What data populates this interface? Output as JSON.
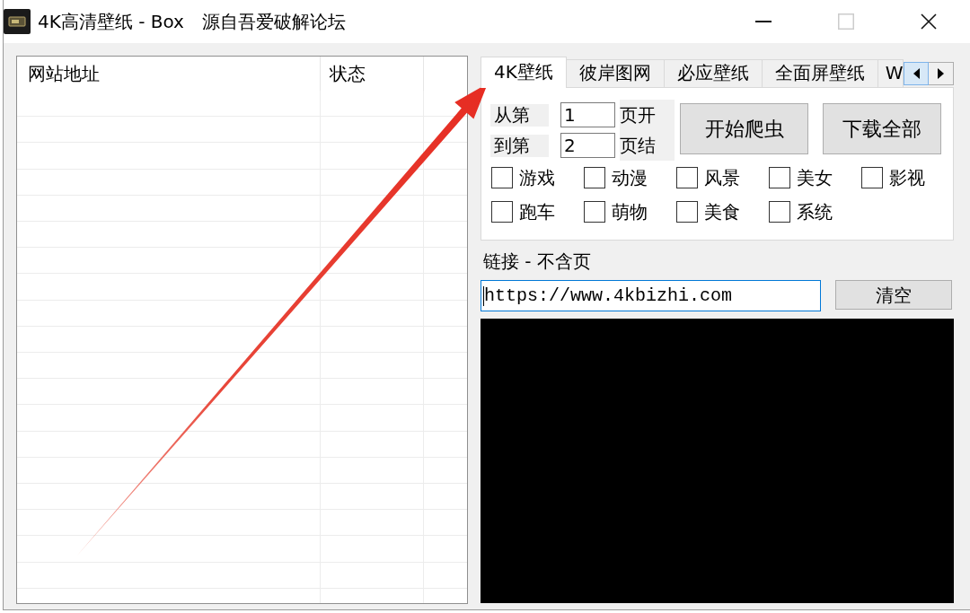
{
  "window": {
    "title": "4K高清壁纸 - Box　源自吾爱破解论坛",
    "buttons": [
      {
        "kind": "minimize",
        "disabled": false
      },
      {
        "kind": "maximize",
        "disabled": true
      },
      {
        "kind": "close",
        "disabled": false
      }
    ]
  },
  "url_list": {
    "columns": [
      "网站地址",
      "状态"
    ]
  },
  "tabs": [
    {
      "label": "4K壁纸",
      "selected": true
    },
    {
      "label": "彼岸图网",
      "selected": false
    },
    {
      "label": "必应壁纸",
      "selected": false
    },
    {
      "label": "全面屏壁纸",
      "selected": false
    },
    {
      "label": "W",
      "selected": false
    }
  ],
  "tab_scroll": [
    {
      "kind": "left",
      "hovered": true
    },
    {
      "kind": "right",
      "hovered": false
    }
  ],
  "page_range": [
    {
      "label": "从第",
      "value": "1",
      "suffix": "页开"
    },
    {
      "label": "到第",
      "value": "2",
      "suffix": "页结"
    }
  ],
  "actions": [
    "开始爬虫",
    "下载全部"
  ],
  "categories": [
    {
      "label": "游戏",
      "checked": false
    },
    {
      "label": "动漫",
      "checked": false
    },
    {
      "label": "风景",
      "checked": false
    },
    {
      "label": "美女",
      "checked": false
    },
    {
      "label": "影视",
      "checked": false
    },
    {
      "label": "跑车",
      "checked": false
    },
    {
      "label": "萌物",
      "checked": false
    },
    {
      "label": "美食",
      "checked": false
    },
    {
      "label": "系统",
      "checked": false
    }
  ],
  "link": {
    "label": "链接 - 不含页",
    "value": "https://www.4kbizhi.com",
    "focused": true,
    "button": "清空"
  }
}
